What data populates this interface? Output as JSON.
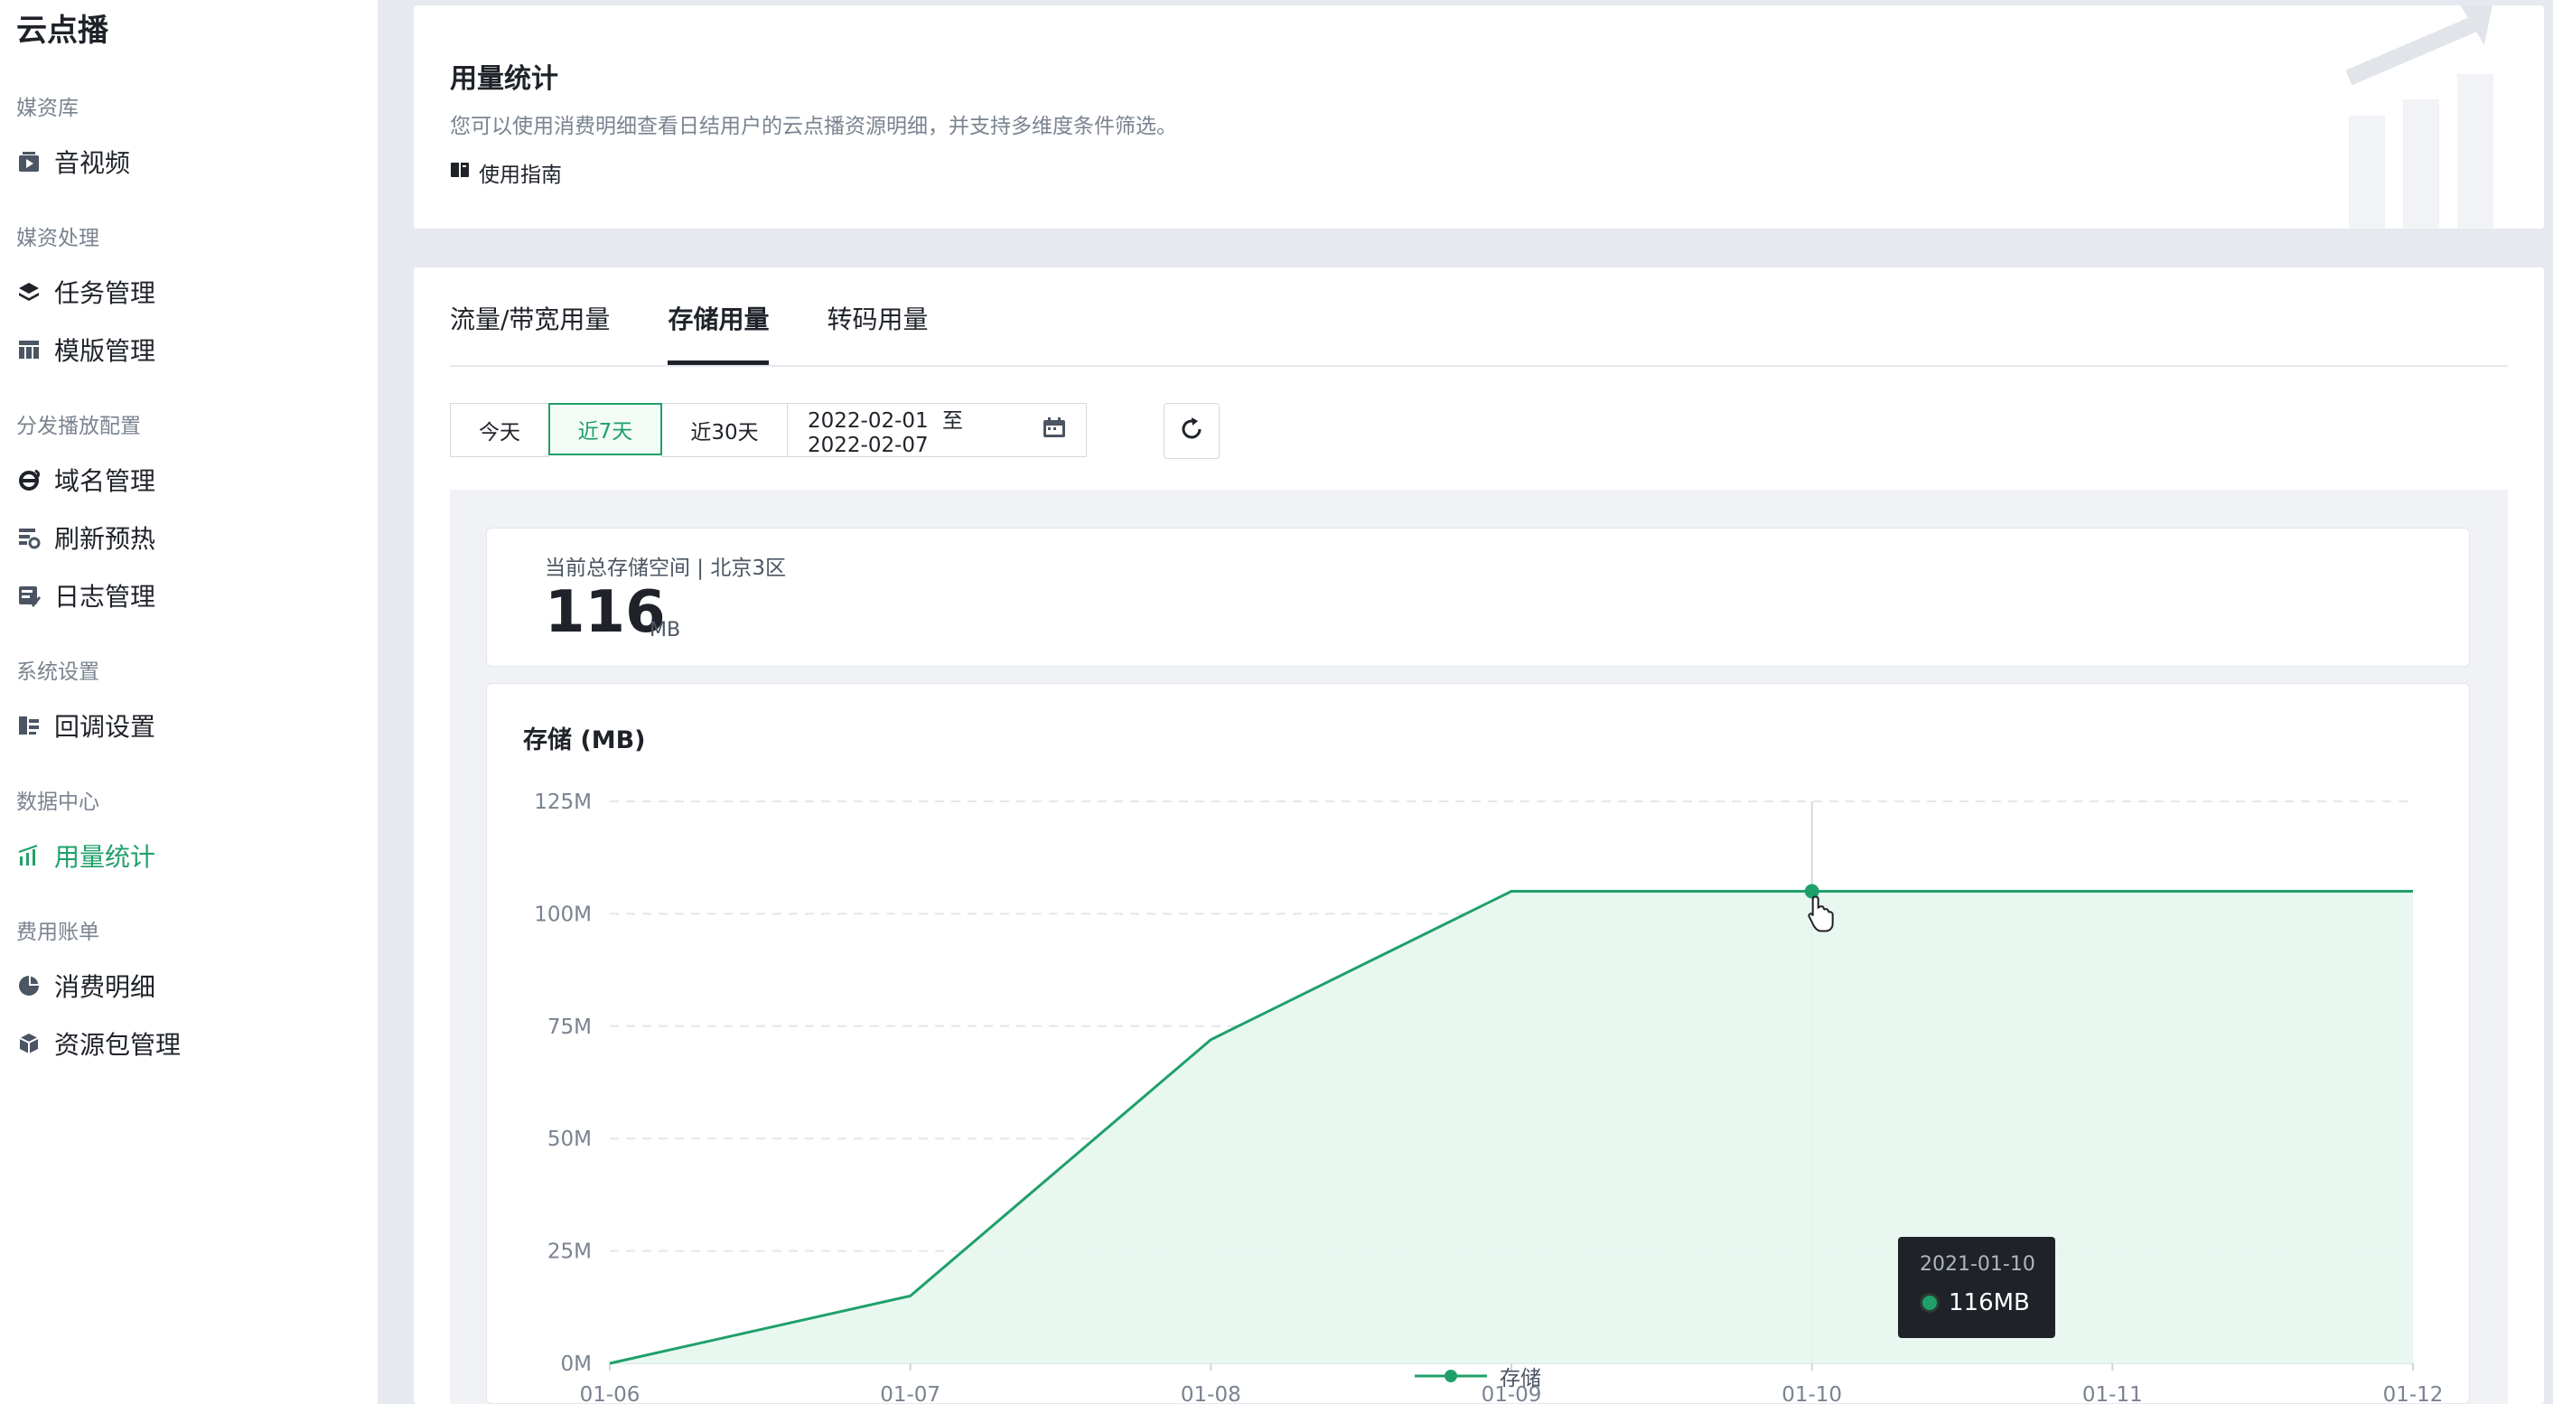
{
  "app_title": "云点播",
  "sidebar": {
    "groups": [
      {
        "title": "媒资库",
        "items": [
          {
            "label": "音视频",
            "icon": "video-library-icon"
          }
        ]
      },
      {
        "title": "媒资处理",
        "items": [
          {
            "label": "任务管理",
            "icon": "layers-icon"
          },
          {
            "label": "模版管理",
            "icon": "table-icon"
          }
        ]
      },
      {
        "title": "分发播放配置",
        "items": [
          {
            "label": "域名管理",
            "icon": "domain-icon"
          },
          {
            "label": "刷新预热",
            "icon": "refresh-cache-icon"
          },
          {
            "label": "日志管理",
            "icon": "log-icon"
          }
        ]
      },
      {
        "title": "系统设置",
        "items": [
          {
            "label": "回调设置",
            "icon": "callback-icon"
          }
        ]
      },
      {
        "title": "数据中心",
        "items": [
          {
            "label": "用量统计",
            "icon": "bar-chart-icon",
            "active": true
          }
        ]
      },
      {
        "title": "费用账单",
        "items": [
          {
            "label": "消费明细",
            "icon": "pie-chart-icon"
          },
          {
            "label": "资源包管理",
            "icon": "package-icon"
          }
        ]
      }
    ]
  },
  "header": {
    "title": "用量统计",
    "description": "您可以使用消费明细查看日结用户的云点播资源明细，并支持多维度条件筛选。",
    "guide_label": "使用指南"
  },
  "tabs": [
    {
      "label": "流量/带宽用量",
      "active": false
    },
    {
      "label": "存储用量",
      "active": true
    },
    {
      "label": "转码用量",
      "active": false
    }
  ],
  "filters": {
    "today": "今天",
    "last7": "近7天",
    "last30": "近30天",
    "active": "last7",
    "date_start": "2022-02-01",
    "date_sep": "至",
    "date_end": "2022-02-07"
  },
  "storage_summary": {
    "label": "当前总存储空间 | 北京3区",
    "value": "116",
    "unit": "MB"
  },
  "chart_data": {
    "type": "area",
    "title": "存储 (MB)",
    "x": [
      "01-06",
      "01-07",
      "01-08",
      "01-09",
      "01-10",
      "01-11",
      "01-12"
    ],
    "series": [
      {
        "name": "存储",
        "values": [
          0,
          15,
          72,
          105,
          105,
          105,
          105
        ],
        "color": "#1fa06a"
      }
    ],
    "yticks": [
      "0M",
      "25M",
      "50M",
      "75M",
      "100M",
      "125M"
    ],
    "ylim": [
      0,
      125
    ],
    "grid": true,
    "legend": "bottom-center",
    "tooltip": {
      "date": "2021-01-10",
      "value": "116MB"
    }
  },
  "colors": {
    "accent": "#1fa06a",
    "fill": "#e6f6ee"
  }
}
